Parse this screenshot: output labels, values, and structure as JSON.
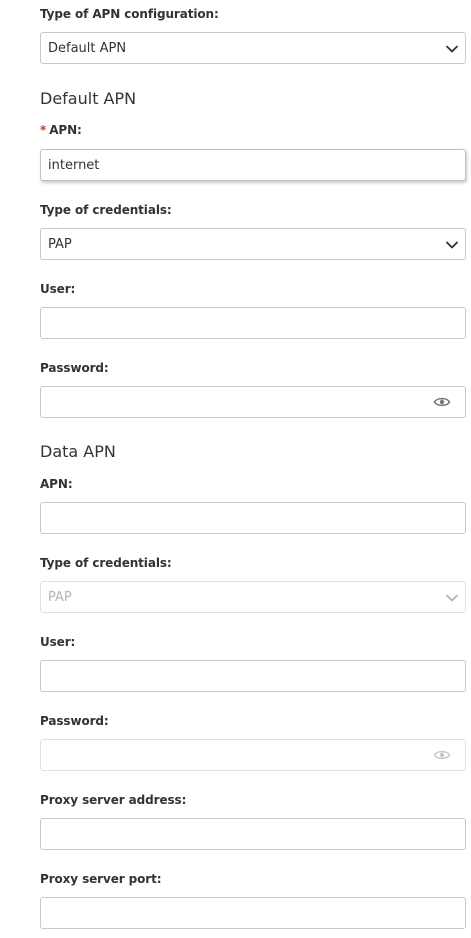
{
  "config_type": {
    "label": "Type of APN configuration:",
    "value": "Default APN"
  },
  "default_apn": {
    "title": "Default APN",
    "apn_required_mark": "*",
    "apn_label": "APN:",
    "apn_value": "internet",
    "cred_label": "Type of credentials:",
    "cred_value": "PAP",
    "user_label": "User:",
    "user_value": "",
    "password_label": "Password:",
    "password_value": ""
  },
  "data_apn": {
    "title": "Data APN",
    "apn_label": "APN:",
    "apn_value": "",
    "cred_label": "Type of credentials:",
    "cred_value": "PAP",
    "user_label": "User:",
    "user_value": "",
    "password_label": "Password:",
    "password_value": "",
    "proxy_address_label": "Proxy server address:",
    "proxy_address_value": "",
    "proxy_port_label": "Proxy server port:",
    "proxy_port_value": ""
  },
  "icons": {
    "dropdown": "chevron-down-icon",
    "show_password": "eye-icon"
  },
  "colors": {
    "required": "#d0311f",
    "text": "#333333",
    "disabled_text": "#b4b4b4",
    "border": "#c8c8c8"
  }
}
